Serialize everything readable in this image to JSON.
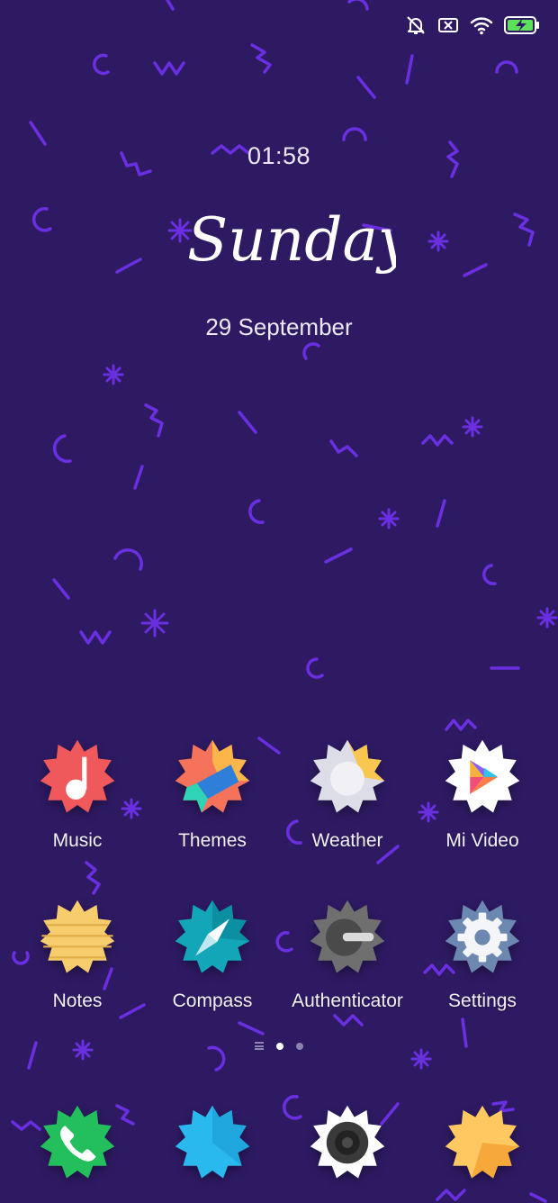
{
  "status_bar": {
    "icons": [
      "mute-icon",
      "sim-off-icon",
      "wifi-icon",
      "battery-charging-icon"
    ],
    "battery_color": "#5ee05a"
  },
  "lock_widget": {
    "time": "01:58",
    "day": "Sunday",
    "date": "29 September"
  },
  "wallpaper": {
    "background": "#2e1a63",
    "squiggle_color": "#6a2fe0"
  },
  "apps": [
    {
      "label": "Music",
      "icon": "music-icon",
      "color": "#f0595b"
    },
    {
      "label": "Themes",
      "icon": "themes-icon",
      "color": "#f5735a"
    },
    {
      "label": "Weather",
      "icon": "weather-icon",
      "color": "#dcdde6"
    },
    {
      "label": "Mi Video",
      "icon": "mi-video-icon",
      "color": "#ffffff"
    },
    {
      "label": "Notes",
      "icon": "notes-icon",
      "color": "#f6cc6c"
    },
    {
      "label": "Compass",
      "icon": "compass-icon",
      "color": "#13a6b8"
    },
    {
      "label": "Authenticator",
      "icon": "authenticator-icon",
      "color": "#6f6f6f"
    },
    {
      "label": "Settings",
      "icon": "settings-icon",
      "color": "#6c88b0"
    }
  ],
  "page_indicator": {
    "pages": 2,
    "current": 1
  },
  "dock": [
    {
      "icon": "phone-icon",
      "color": "#22bf5c"
    },
    {
      "icon": "messaging-icon",
      "color": "#29b9ef"
    },
    {
      "icon": "camera-icon",
      "color": "#ffffff"
    },
    {
      "icon": "browser-icon",
      "color": "#ffbd4e"
    }
  ]
}
